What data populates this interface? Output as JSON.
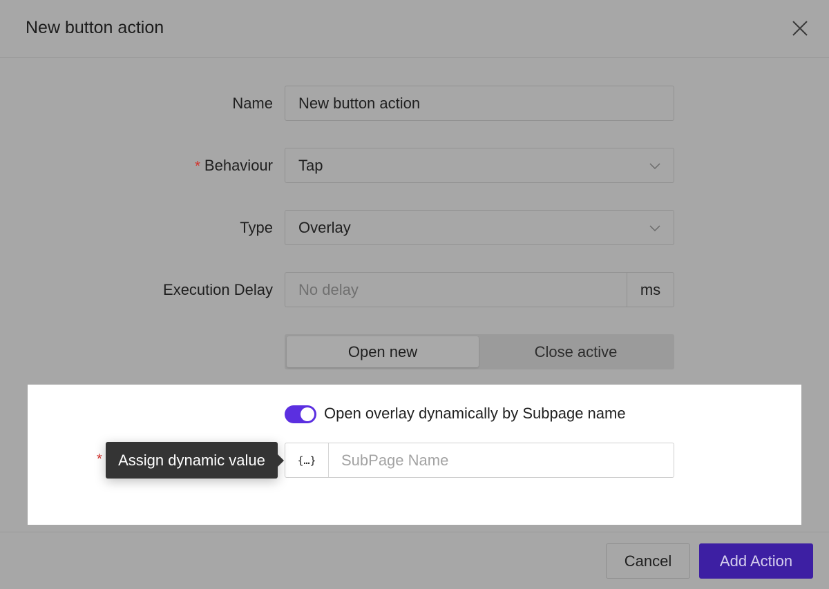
{
  "dialog": {
    "title": "New button action"
  },
  "form": {
    "name": {
      "label": "Name",
      "value": "New button action"
    },
    "behaviour": {
      "label": "Behaviour",
      "required_mark": "*",
      "value": "Tap"
    },
    "type": {
      "label": "Type",
      "value": "Overlay"
    },
    "execution_delay": {
      "label": "Execution Delay",
      "placeholder": "No delay",
      "suffix": "ms"
    },
    "overlay_mode": {
      "options": [
        "Open new",
        "Close active"
      ],
      "selected": "Open new"
    },
    "dynamic_toggle": {
      "label": "Open overlay dynamically by Subpage name",
      "on": true
    },
    "subpage": {
      "required_mark": "*",
      "prefix_icon": "{…}",
      "placeholder": "SubPage Name"
    }
  },
  "tooltip": {
    "text": "Assign dynamic value"
  },
  "footer": {
    "cancel_label": "Cancel",
    "add_label": "Add Action"
  },
  "colors": {
    "accent": "#5b2fe0",
    "overlay_bg": "#a7a7a7",
    "required": "#d4302a"
  },
  "icons": {
    "close": "close-icon",
    "dropdown": "chevron-down-icon",
    "dynamic": "curly-braces-icon"
  }
}
